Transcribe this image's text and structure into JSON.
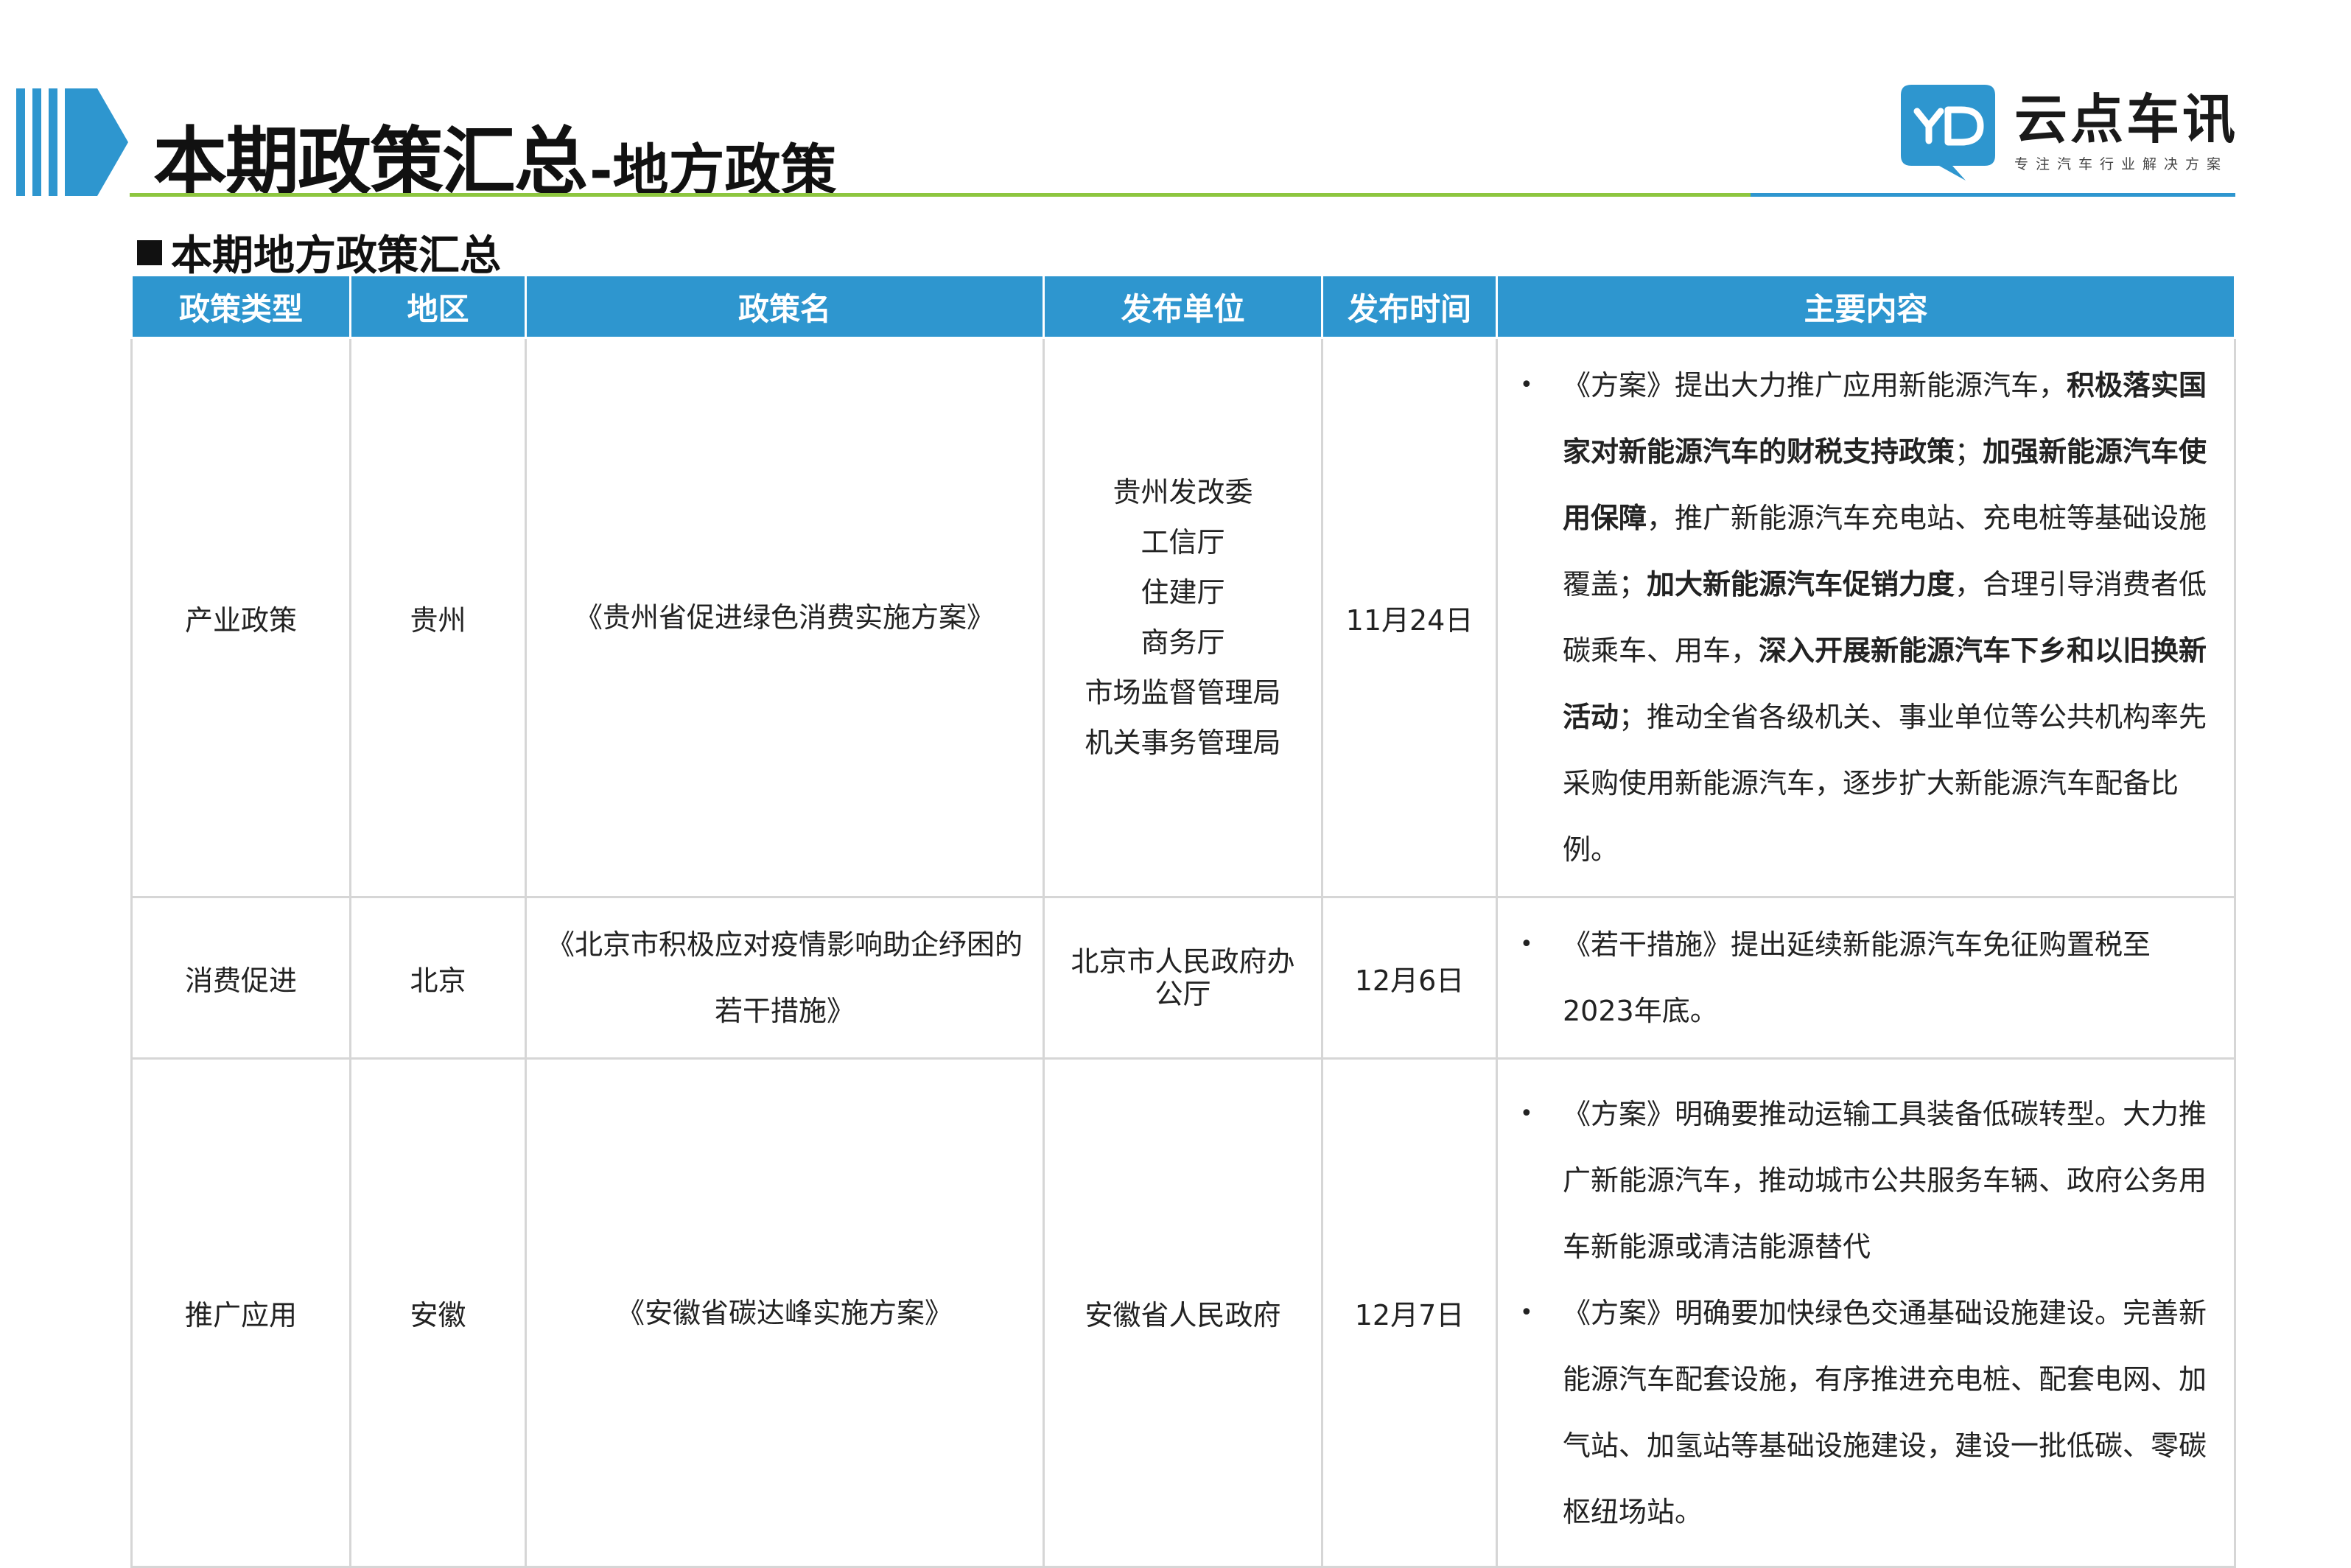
{
  "header": {
    "title_main": "本期政策汇总",
    "title_sub": "-地方政策",
    "accent_color": "#2e96cf",
    "rule_color": "#8dc63f"
  },
  "logo": {
    "mark_icon": "yd-logo-icon",
    "name": "云点车讯",
    "tagline": "专注汽车行业解决方案"
  },
  "section_title": "本期地方政策汇总",
  "table": {
    "headers": [
      "政策类型",
      "地区",
      "政策名",
      "发布单位",
      "发布时间",
      "主要内容"
    ],
    "rows": [
      {
        "type": "产业政策",
        "region": "贵州",
        "name_lines": [
          "《贵州省促进绿色消费实施方案》"
        ],
        "publishers": [
          "贵州发改委",
          "工信厅",
          "住建厅",
          "商务厅",
          "市场监督管理局",
          "机关事务管理局"
        ],
        "date": "11月24日",
        "content": [
          [
            {
              "t": "《方案》提出大力推广应用新能源汽车，",
              "b": false
            },
            {
              "t": "积极落实国家对新能源汽车的财税支持政策",
              "b": true
            },
            {
              "t": "；",
              "b": false
            },
            {
              "t": "加强新能源汽车使用保障",
              "b": true
            },
            {
              "t": "，推广新能源汽车充电站、充电桩等基础设施覆盖；",
              "b": false
            },
            {
              "t": "加大新能源汽车促销力度",
              "b": true
            },
            {
              "t": "，合理引导消费者低碳乘车、用车，",
              "b": false
            },
            {
              "t": "深入开展新能源汽车下乡和以旧换新活动",
              "b": true
            },
            {
              "t": "；推动全省各级机关、事业单位等公共机构率先采购使用新能源汽车，逐步扩大新能源汽车配备比例。",
              "b": false
            }
          ]
        ]
      },
      {
        "type": "消费促进",
        "region": "北京",
        "name_lines": [
          "《北京市积极应对疫情影响助企纾困的",
          "若干措施》"
        ],
        "publishers": [
          "北京市人民政府办",
          "公厅"
        ],
        "date": "12月6日",
        "content": [
          [
            {
              "t": "《若干措施》提出延续新能源汽车免征购置税至2023年底。",
              "b": false
            }
          ]
        ]
      },
      {
        "type": "推广应用",
        "region": "安徽",
        "name_lines": [
          "《安徽省碳达峰实施方案》"
        ],
        "publishers": [
          "安徽省人民政府"
        ],
        "date": "12月7日",
        "content": [
          [
            {
              "t": "《方案》明确要推动运输工具装备低碳转型。大力推广新能源汽车，推动城市公共服务车辆、政府公务用车新能源或清洁能源替代",
              "b": false
            }
          ],
          [
            {
              "t": "《方案》明确要加快绿色交通基础设施建设。完善新能源汽车配套设施，有序推进充电桩、配套电网、加气站、加氢站等基础设施建设，建设一批低碳、零碳枢纽场站。",
              "b": false
            }
          ]
        ]
      }
    ]
  }
}
